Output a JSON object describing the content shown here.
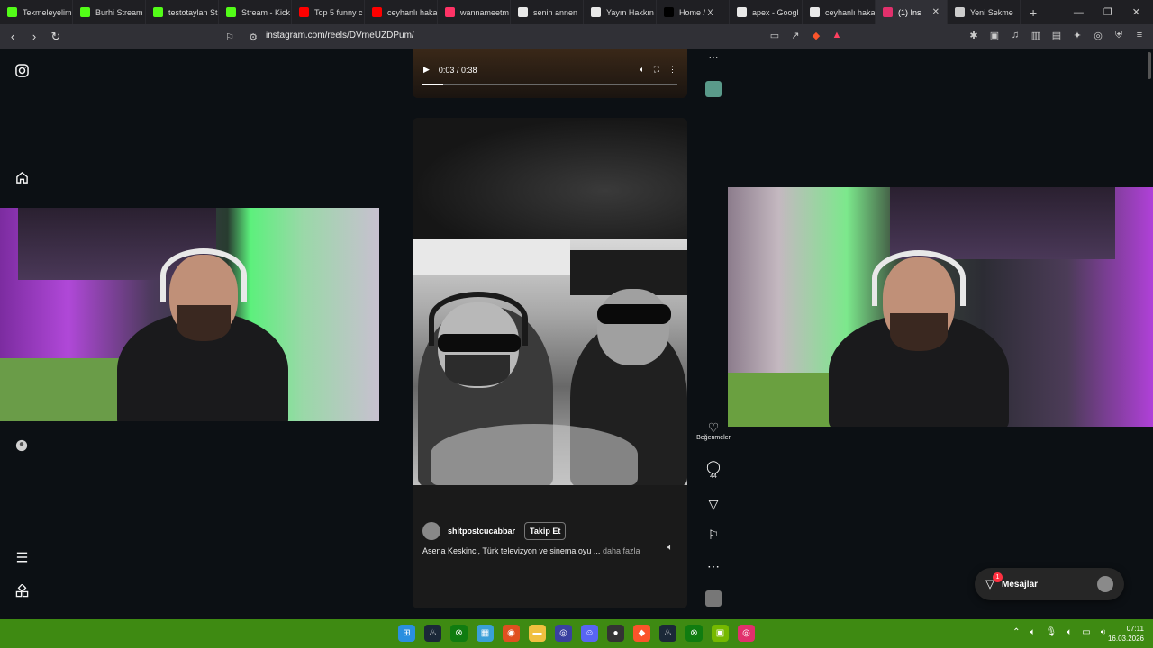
{
  "browser": {
    "tabs": [
      {
        "title": "Tekmeleyelim",
        "icon": "kick-icon",
        "color": "#53fc18"
      },
      {
        "title": "Burhi Stream",
        "icon": "kick-icon",
        "color": "#53fc18"
      },
      {
        "title": "testotaylan St",
        "icon": "kick-icon",
        "color": "#53fc18"
      },
      {
        "title": "Stream - Kick",
        "icon": "kick-icon",
        "color": "#53fc18"
      },
      {
        "title": "Top 5 funny c",
        "icon": "youtube-icon",
        "color": "#ff0000"
      },
      {
        "title": "ceyhanlı haka",
        "icon": "youtube-icon",
        "color": "#ff0000"
      },
      {
        "title": "wannameetm",
        "icon": "music-icon",
        "color": "#ff3366"
      },
      {
        "title": "senin annen",
        "icon": "google-icon",
        "color": "#e8e8e8"
      },
      {
        "title": "Yayın Hakkın",
        "icon": "doc-icon",
        "color": "#e8e8e8"
      },
      {
        "title": "Home / X",
        "icon": "x-icon",
        "color": "#000000"
      },
      {
        "title": "apex - Googl",
        "icon": "google-icon",
        "color": "#e8e8e8"
      },
      {
        "title": "ceyhanlı haka",
        "icon": "google-icon",
        "color": "#e8e8e8"
      },
      {
        "title": "(1) Ins",
        "icon": "instagram-icon",
        "color": "#e1306c",
        "active": true
      },
      {
        "title": "Yeni Sekme",
        "icon": "shield-icon",
        "color": "#cccccc"
      }
    ],
    "url": "instagram.com/reels/DVrneUZDPum/"
  },
  "player_top": {
    "time": "0:03 / 0:38",
    "progress": 0.08
  },
  "reel": {
    "username": "shitpostcucabbar",
    "follow_label": "Takip Et",
    "caption": "Asena Keskinci, Türk televizyon ve sinema oyu ...",
    "more_label": "daha fazla"
  },
  "actions": {
    "like_label": "Beğenmeler",
    "comment_count": "44"
  },
  "messages": {
    "label": "Mesajlar",
    "badge": "1"
  },
  "taskbar": {
    "time": "07:11",
    "date": "16.03.2026"
  }
}
